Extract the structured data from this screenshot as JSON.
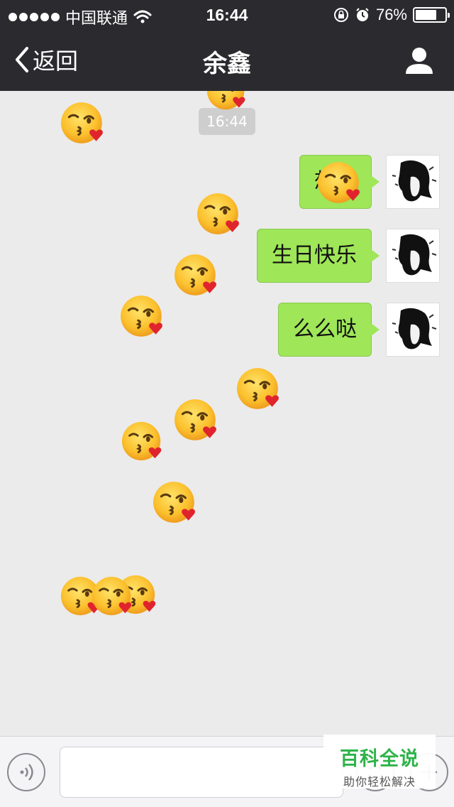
{
  "status_bar": {
    "carrier": "中国联通",
    "time": "16:44",
    "battery_percent": "76%",
    "battery_level": 0.76,
    "icons": [
      "signal-dots",
      "wifi-icon",
      "rotation-lock-icon",
      "alarm-icon",
      "battery-icon"
    ]
  },
  "nav": {
    "back_label": "返回",
    "title": "余鑫",
    "icons": [
      "chevron-left-icon",
      "profile-icon"
    ]
  },
  "chat": {
    "timestamp": "16:44",
    "messages": [
      {
        "sender": "me",
        "text": "想你"
      },
      {
        "sender": "me",
        "text": "生日快乐"
      },
      {
        "sender": "me",
        "text": "么么哒"
      }
    ],
    "effect_emoji": "kissing-face-with-heart-emoji"
  },
  "input_bar": {
    "message_value": "",
    "icons": [
      "voice-icon",
      "emoji-icon",
      "plus-icon"
    ]
  },
  "watermark": {
    "brand": "百科全说",
    "slogan": "助你轻松解决"
  },
  "colors": {
    "header_bg": "#2b2b2f",
    "chat_bg": "#ebebeb",
    "bubble": "#9fe658",
    "timestamp_pill": "#cecece",
    "watermark_green": "#2fb34a"
  }
}
